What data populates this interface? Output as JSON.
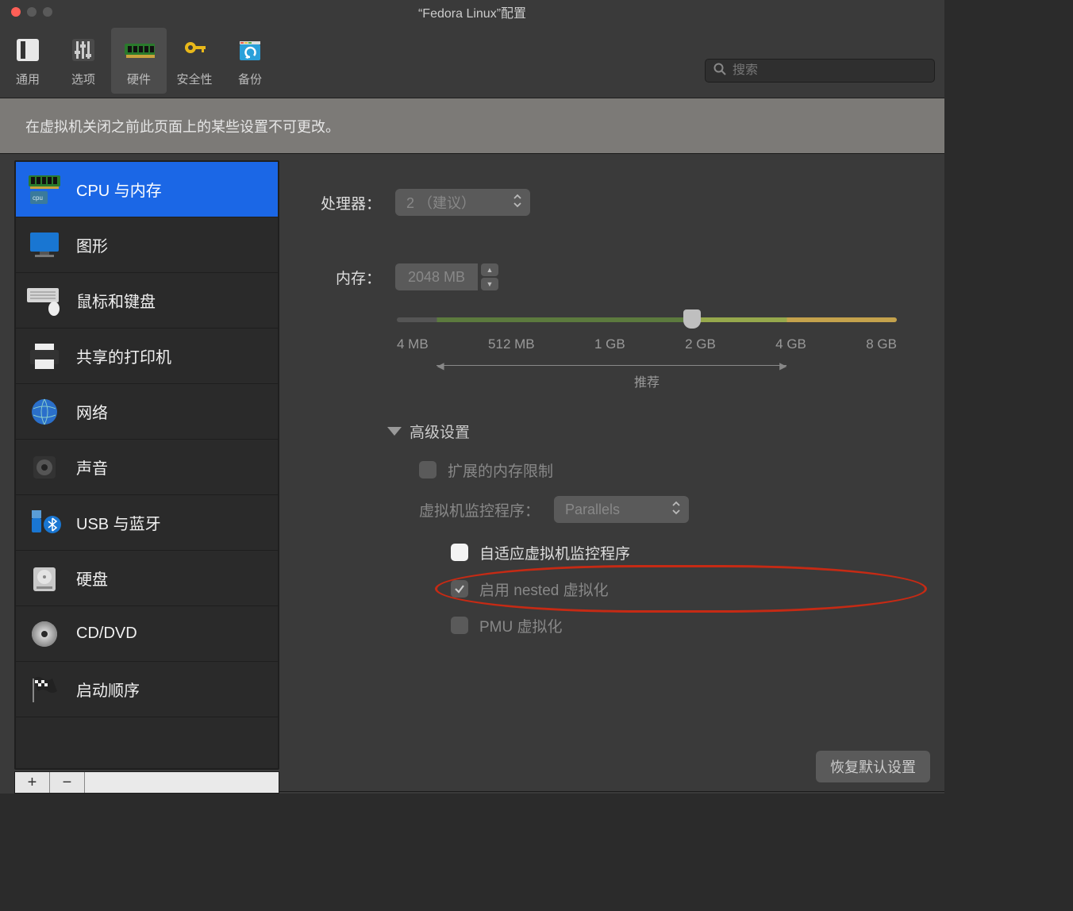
{
  "window": {
    "title": "“Fedora Linux”配置"
  },
  "toolbar": {
    "items": [
      {
        "label": "通用"
      },
      {
        "label": "选项"
      },
      {
        "label": "硬件"
      },
      {
        "label": "安全性"
      },
      {
        "label": "备份"
      }
    ],
    "search_placeholder": "搜索"
  },
  "banner": "在虚拟机关闭之前此页面上的某些设置不可更改。",
  "sidebar": {
    "items": [
      {
        "label": "CPU 与内存"
      },
      {
        "label": "图形"
      },
      {
        "label": "鼠标和键盘"
      },
      {
        "label": "共享的打印机"
      },
      {
        "label": "网络"
      },
      {
        "label": "声音"
      },
      {
        "label": "USB 与蓝牙"
      },
      {
        "label": "硬盘"
      },
      {
        "label": "CD/DVD"
      },
      {
        "label": "启动顺序"
      }
    ]
  },
  "pane": {
    "processor_label": "处理器：",
    "processor_value": "2 （建议）",
    "memory_label": "内存：",
    "memory_value": "2048 MB",
    "slider_ticks": [
      "4 MB",
      "512 MB",
      "1 GB",
      "2 GB",
      "4 GB",
      "8 GB"
    ],
    "recommended": "推荐",
    "advanced_label": "高级设置",
    "ext_mem_limit": "扩展的内存限制",
    "hypervisor_label": "虚拟机监控程序：",
    "hypervisor_value": "Parallels",
    "adaptive_hv": "自适应虚拟机监控程序",
    "nested_virt": "启用 nested 虚拟化",
    "pmu_virt": "PMU 虚拟化",
    "restore": "恢复默认设置"
  }
}
